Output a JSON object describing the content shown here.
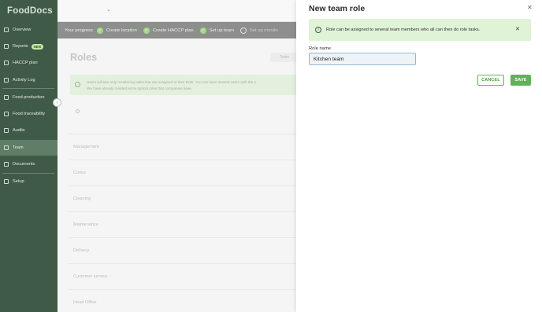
{
  "app": {
    "logo": "FoodDocs"
  },
  "sidebar": {
    "items": [
      {
        "label": "Overview",
        "icon": "home-icon"
      },
      {
        "label": "Reports",
        "icon": "report-icon",
        "badge": "NEW"
      },
      {
        "label": "HACCP plan",
        "icon": "book-icon"
      },
      {
        "label": "Activity Log",
        "icon": "chart-icon"
      },
      {
        "label": "Food production",
        "icon": "production-icon"
      },
      {
        "label": "Food traceability",
        "icon": "search-icon"
      },
      {
        "label": "Audits",
        "icon": "clipboard-icon"
      },
      {
        "label": "Team",
        "icon": "user-icon",
        "active": true
      },
      {
        "label": "Documents",
        "icon": "document-icon"
      },
      {
        "label": "Setup",
        "icon": "gear-icon"
      }
    ],
    "collapse_glyph": "‹"
  },
  "progress": {
    "label": "Your progress",
    "steps": [
      {
        "label": "Create location",
        "done": true
      },
      {
        "label": "Create HACCP plan",
        "done": true
      },
      {
        "label": "Set up team",
        "done": true
      },
      {
        "label": "Set up monito",
        "done": false
      }
    ]
  },
  "main": {
    "title": "Roles",
    "search_placeholder": "Team",
    "info_line1": "Users will see only monitoring tasks that are assigned to their Role. You can have several users with the s",
    "info_line2": "We have already created some typical roles that companies have.",
    "roles": [
      "Management",
      "Cooks",
      "Cleaning",
      "Maintenance",
      "Delivery",
      "Customer service",
      "Head Office"
    ]
  },
  "panel": {
    "title": "New team role",
    "close_glyph": "✕",
    "alert_text": "Role can be assigned to several team members who all can then do role tasks.",
    "alert_close": "✕",
    "field_label": "Role name",
    "field_value": "Kitchen team",
    "cancel_label": "CANCEL",
    "save_label": "SAVE"
  },
  "colors": {
    "sidebar": "#3f5a46",
    "accent": "#5fb356",
    "alert_bg": "#dff3d6"
  }
}
